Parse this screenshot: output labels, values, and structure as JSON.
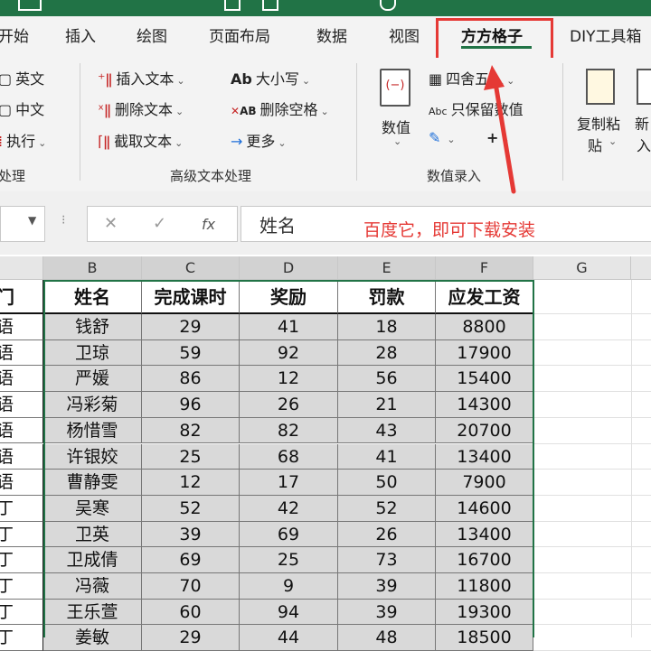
{
  "tabs": [
    "开始",
    "插入",
    "绘图",
    "页面布局",
    "数据",
    "视图",
    "方方格子",
    "DIY工具箱"
  ],
  "ribbon": {
    "left_items": [
      "英文",
      "中文",
      "执行"
    ],
    "left_group": "处理",
    "text_tools": [
      "插入文本",
      "删除文本",
      "截取文本"
    ],
    "case_tools": [
      "大小写",
      "删除空格",
      "更多"
    ],
    "text_group": "高级文本处理",
    "numeric_btn": "数值",
    "rounding": "四舍五入",
    "keep_value": "只保留数值",
    "numeric_group": "数值录入",
    "copy_paste_1": "复制粘",
    "copy_paste_2": "贴",
    "new_1": "新",
    "new_2": "入"
  },
  "formula": {
    "fx": "fx",
    "content": "姓名",
    "annotation": "百度它，即可下载安装"
  },
  "columns": [
    "B",
    "C",
    "D",
    "E",
    "F",
    "G"
  ],
  "left_col_header": "门",
  "left_col_values": [
    "语",
    "语",
    "语",
    "语",
    "语",
    "语",
    "语",
    "丁",
    "丁",
    "丁",
    "丁",
    "丁",
    "丁"
  ],
  "table_headers": [
    "姓名",
    "完成课时",
    "奖励",
    "罚款",
    "应发工资"
  ],
  "rows": [
    [
      "钱舒",
      "29",
      "41",
      "18",
      "8800"
    ],
    [
      "卫琼",
      "59",
      "92",
      "28",
      "17900"
    ],
    [
      "严媛",
      "86",
      "12",
      "56",
      "15400"
    ],
    [
      "冯彩菊",
      "96",
      "26",
      "21",
      "14300"
    ],
    [
      "杨惜雪",
      "82",
      "82",
      "43",
      "20700"
    ],
    [
      "许银姣",
      "25",
      "68",
      "41",
      "13400"
    ],
    [
      "曹静雯",
      "12",
      "17",
      "50",
      "7900"
    ],
    [
      "吴寒",
      "52",
      "42",
      "52",
      "14600"
    ],
    [
      "卫英",
      "39",
      "69",
      "26",
      "13400"
    ],
    [
      "卫成倩",
      "69",
      "25",
      "73",
      "16700"
    ],
    [
      "冯薇",
      "70",
      "9",
      "39",
      "11800"
    ],
    [
      "王乐萱",
      "60",
      "94",
      "39",
      "19300"
    ],
    [
      "姜敏",
      "29",
      "44",
      "48",
      "18500"
    ]
  ],
  "colors": {
    "excel_green": "#217346",
    "annotation_red": "#e53935"
  }
}
